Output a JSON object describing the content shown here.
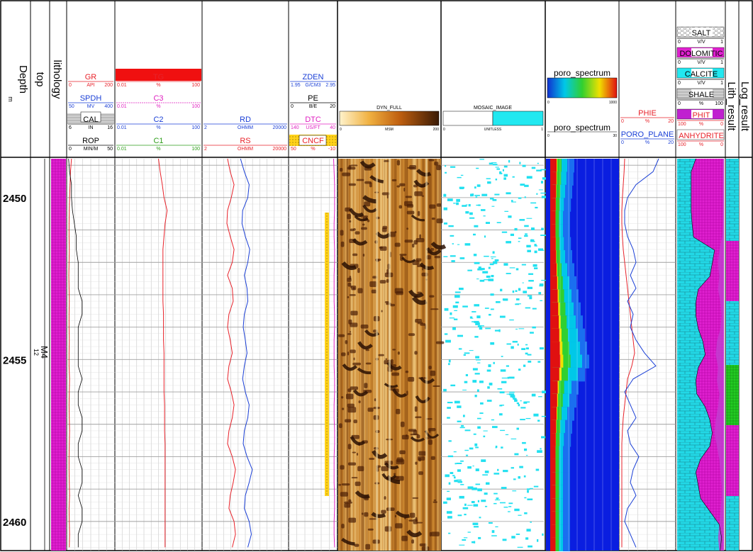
{
  "columns": {
    "depth": {
      "title": "Depth",
      "unit": "m"
    },
    "top": {
      "title": "top",
      "zone": "M4",
      "zone_sub": "12"
    },
    "lithology": {
      "title": "lithology"
    },
    "log_result": {
      "title": "Log_result"
    },
    "lith_result": {
      "title": "Lith_result"
    }
  },
  "track1": {
    "curves": [
      {
        "name": "GR",
        "unit": "API",
        "min": "0",
        "max": "200",
        "color": "#e8222a"
      },
      {
        "name": "SPDH",
        "unit": "MV",
        "min": "50",
        "max": "400",
        "color": "#1a3fd6"
      },
      {
        "name": "CAL",
        "unit": "IN",
        "min": "6",
        "max": "16",
        "color": "#000000"
      },
      {
        "name": "ROP",
        "unit": "MIN/M",
        "min": "0",
        "max": "50",
        "color": "#000000"
      }
    ]
  },
  "track2": {
    "curves": [
      {
        "name": "TG",
        "unit": "%",
        "min": "0.01",
        "max": "100",
        "color": "#e8222a"
      },
      {
        "name": "C3",
        "unit": "%",
        "min": "0.01",
        "max": "100",
        "color": "#e020c0"
      },
      {
        "name": "C2",
        "unit": "%",
        "min": "0.01",
        "max": "100",
        "color": "#1a3fd6"
      },
      {
        "name": "C1",
        "unit": "%",
        "min": "0.01",
        "max": "100",
        "color": "#2e9e1a"
      }
    ]
  },
  "track3": {
    "curves": [
      {
        "name": "RD",
        "unit": "OHMM",
        "min": "2",
        "max": "20000",
        "color": "#1a3fd6"
      },
      {
        "name": "RS",
        "unit": "OHMM",
        "min": "2",
        "max": "20000",
        "color": "#e8222a"
      }
    ]
  },
  "track4": {
    "curves": [
      {
        "name": "ZDEN",
        "unit": "G/CM3",
        "min": "1.95",
        "max": "2.95",
        "color": "#1a3fd6"
      },
      {
        "name": "PE",
        "unit": "B/E",
        "min": "0",
        "max": "20",
        "color": "#000000"
      },
      {
        "name": "DTC",
        "unit": "US/FT",
        "min": "140",
        "max": "40",
        "color": "#e020c0"
      },
      {
        "name": "CNCF",
        "unit": "%",
        "min": "50",
        "max": "-10",
        "color": "#e8222a"
      }
    ]
  },
  "track5": {
    "name": "DYN_FULL",
    "unit": "MSM",
    "min": "0",
    "max": "200"
  },
  "track6": {
    "name": "MOSAIC_IMAGE",
    "unit": "UNITLESS",
    "min": "0",
    "max": "1"
  },
  "track7": {
    "name1": "poro_spectrum",
    "min1": "0",
    "max1": "1000",
    "name2": "poro_spectrum",
    "min2": "0",
    "max2": "30"
  },
  "track8": {
    "curves": [
      {
        "name": "PORO_PLANE",
        "unit": "%",
        "min": "0",
        "max": "20",
        "color": "#1a3fd6"
      },
      {
        "name": "PHIE",
        "unit": "%",
        "min": "0",
        "max": "20",
        "color": "#e8222a"
      }
    ]
  },
  "track9": {
    "curves": [
      {
        "name": "SALT",
        "unit": "V/V",
        "min": "0",
        "max": "1"
      },
      {
        "name": "DOLOMITIC",
        "unit": "V/V",
        "min": "0",
        "max": "1"
      },
      {
        "name": "CALCITE",
        "unit": "V/V",
        "min": "0",
        "max": "1"
      },
      {
        "name": "SHALE",
        "unit": "%",
        "min": "0",
        "max": "100"
      },
      {
        "name": "PHIT",
        "unit": "%",
        "min": "100",
        "max": "0"
      },
      {
        "name": "ANHYDRITE",
        "unit": "%",
        "min": "100",
        "max": "0"
      }
    ]
  },
  "chart_data": {
    "type": "line",
    "depth_range": [
      2448.8,
      2460.9
    ],
    "depth_ticks": [
      "2450",
      "2455",
      "2460"
    ],
    "depth_tick_values": [
      2450,
      2455,
      2460
    ],
    "depth": [
      2448.8,
      2449.2,
      2449.6,
      2450.0,
      2450.4,
      2450.8,
      2451.2,
      2451.6,
      2452.0,
      2452.4,
      2452.8,
      2453.2,
      2453.6,
      2454.0,
      2454.4,
      2454.8,
      2455.2,
      2455.6,
      2456.0,
      2456.4,
      2456.8,
      2457.2,
      2457.6,
      2458.0,
      2458.4,
      2458.8,
      2459.2,
      2459.6,
      2460.0,
      2460.4,
      2460.8
    ],
    "series": [
      {
        "name": "GR",
        "values": [
          20,
          16,
          14,
          12,
          11,
          10,
          10,
          11,
          10,
          9,
          10,
          11,
          10,
          10,
          11,
          10,
          10,
          12,
          11,
          10,
          11,
          12,
          11,
          10,
          10,
          11,
          12,
          10,
          11,
          12,
          11
        ]
      },
      {
        "name": "ROP",
        "values": [
          2,
          3,
          5,
          5,
          6,
          8,
          10,
          10,
          12,
          12,
          12,
          16,
          16,
          12,
          12,
          12,
          12,
          16,
          12,
          12,
          16,
          16,
          12,
          12,
          16,
          16,
          12,
          16,
          16,
          12,
          12
        ]
      },
      {
        "name": "TG",
        "values": [
          1.0,
          1.2,
          1.5,
          1.8,
          2.5,
          2.0,
          1.8,
          1.6,
          1.6,
          1.6,
          1.6,
          1.6,
          1.7,
          1.7,
          1.7,
          1.8,
          1.8,
          1.8,
          1.8,
          1.9,
          1.9,
          1.9,
          2.0,
          2.0,
          2.0,
          2.0,
          2.0,
          2.0,
          2.0,
          2.0,
          2.0
        ]
      },
      {
        "name": "RD",
        "values": [
          120,
          180,
          300,
          260,
          150,
          140,
          200,
          320,
          260,
          180,
          240,
          260,
          180,
          160,
          200,
          240,
          180,
          150,
          200,
          300,
          260,
          180,
          160,
          240,
          420,
          300,
          200,
          180,
          300,
          380,
          260
        ]
      },
      {
        "name": "RS",
        "values": [
          30,
          40,
          60,
          45,
          30,
          28,
          40,
          60,
          50,
          30,
          50,
          55,
          35,
          30,
          40,
          50,
          35,
          30,
          45,
          60,
          50,
          35,
          30,
          50,
          70,
          55,
          40,
          35,
          60,
          70,
          50
        ]
      },
      {
        "name": "DTC",
        "values": [
          48,
          47,
          46,
          46,
          46,
          47,
          47,
          46,
          46,
          47,
          47,
          47,
          46,
          46,
          47,
          47,
          47,
          46,
          46,
          47,
          47,
          46,
          46,
          47,
          47,
          47,
          46,
          46,
          47,
          47,
          46
        ]
      },
      {
        "name": "PHIE",
        "values": [
          2,
          1.8,
          1.5,
          1.2,
          1.0,
          1.0,
          1.2,
          1.5,
          2.0,
          2.5,
          3.0,
          3.5,
          4.0,
          4.5,
          5.0,
          5.5,
          4.5,
          3.0,
          2.5,
          2.0,
          1.5,
          1.2,
          1.0,
          1.0,
          1.0,
          1.0,
          1.0,
          1.0,
          1.0,
          1.0,
          1.0
        ]
      },
      {
        "name": "PORO_PLANE",
        "values": [
          14,
          12,
          6,
          3,
          2,
          2,
          3,
          5,
          6,
          4,
          6,
          3,
          5,
          4,
          6,
          9,
          13,
          5,
          2,
          4,
          6,
          3,
          4,
          7,
          5,
          4,
          6,
          3,
          2,
          4,
          6
        ]
      },
      {
        "name": "SHALE",
        "values": [
          5,
          6,
          8,
          7,
          6,
          6,
          7,
          8,
          7,
          6,
          7,
          8,
          7,
          6,
          7,
          8,
          7,
          6,
          7,
          8,
          7,
          6,
          7,
          8,
          7,
          6,
          7,
          8,
          7,
          6,
          7
        ]
      },
      {
        "name": "ANHYDRITE",
        "values": [
          60,
          70,
          70,
          70,
          70,
          68,
          65,
          20,
          25,
          30,
          55,
          60,
          60,
          55,
          45,
          40,
          55,
          60,
          58,
          40,
          30,
          25,
          30,
          50,
          60,
          55,
          50,
          30,
          10,
          5,
          8
        ]
      },
      {
        "name": "PHIT",
        "values": [
          5,
          5,
          5,
          5,
          5,
          5,
          8,
          20,
          25,
          20,
          25,
          15,
          10,
          15,
          30,
          35,
          25,
          30,
          20,
          25,
          35,
          40,
          30,
          20,
          15,
          10,
          10,
          15,
          20,
          25,
          20
        ]
      }
    ]
  }
}
